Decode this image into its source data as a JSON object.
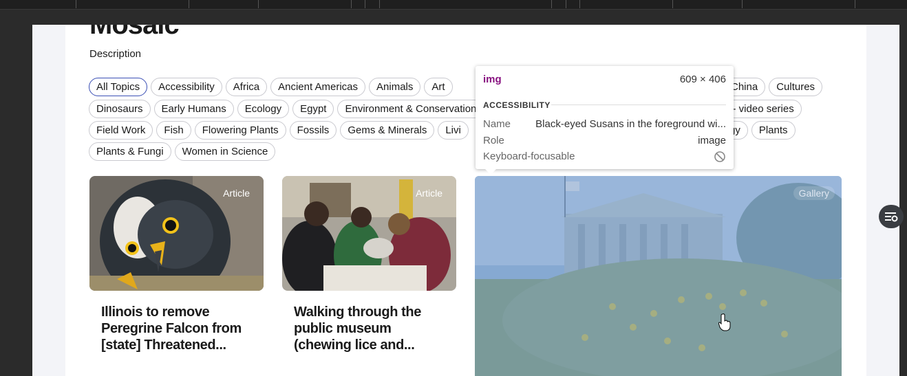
{
  "page": {
    "title": "Mosaic",
    "description": "Description"
  },
  "topics": {
    "row1": [
      "All Topics",
      "Accessibility",
      "Africa",
      "Ancient Americas",
      "Animals",
      "Art"
    ],
    "row1_right": [
      "China",
      "Cultures"
    ],
    "row2": [
      "Dinosaurs",
      "Early Humans",
      "Ecology",
      "Egypt",
      "Environment & Conservation"
    ],
    "row2_right": [
      "d - video series"
    ],
    "row3": [
      "Field Work",
      "Fish",
      "Flowering Plants",
      "Fossils",
      "Gems & Minerals",
      "Livi"
    ],
    "row3_right": [
      "gy",
      "Plants"
    ],
    "row4": [
      "Plants & Fungi",
      "Women in Science"
    ]
  },
  "cards": [
    {
      "badge": "Article",
      "title": "Illinois to remove Peregrine Falcon from [state] Threatened..."
    },
    {
      "badge": "Article",
      "title": "Walking through the public museum (chewing lice and..."
    }
  ],
  "gallery": {
    "badge": "Gallery"
  },
  "tooltip": {
    "tag": "img",
    "dims": "609 × 406",
    "section": "ACCESSIBILITY",
    "name_label": "Name",
    "name_value": "Black-eyed Susans in the foreground wi...",
    "role_label": "Role",
    "role_value": "image",
    "focus_label": "Keyboard-focusable"
  },
  "colors": {
    "accent": "#3a4fb5",
    "tag": "#881280"
  }
}
